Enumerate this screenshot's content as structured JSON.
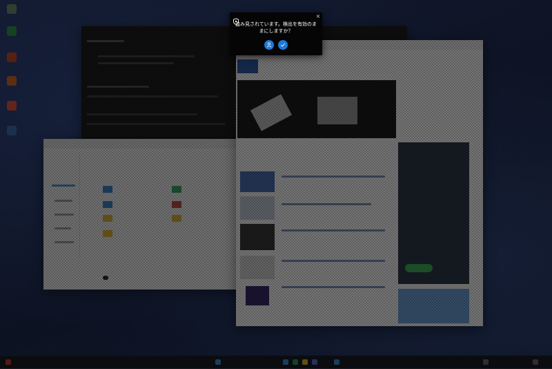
{
  "popup": {
    "message": "盗み見されています。検出を有効のままにしますか？",
    "close_glyph": "×",
    "icon": "eye-shield-icon",
    "buttons": [
      {
        "icon": "lock-person-icon"
      },
      {
        "icon": "checkmark-icon"
      }
    ],
    "accent_color": "#1e78d6"
  },
  "colors": {
    "popup_bg": "#050505",
    "overlay": "rgba(0,0,0,0.52)",
    "desktop": "#27314f"
  }
}
